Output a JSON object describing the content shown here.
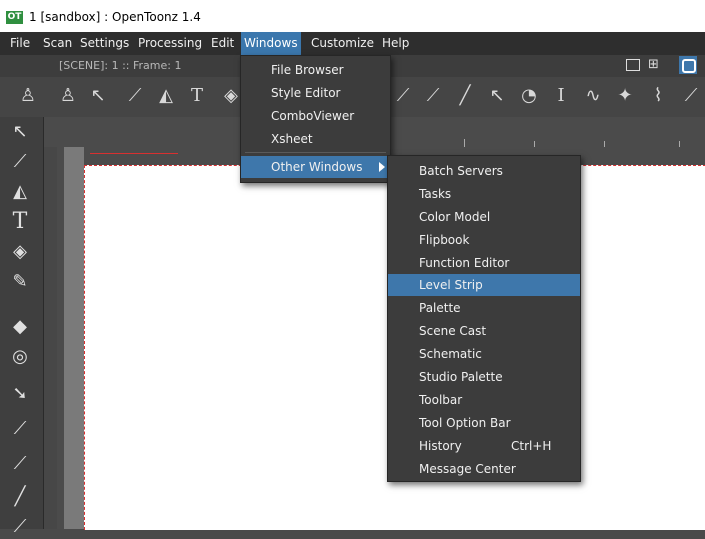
{
  "window": {
    "app_icon": "OT",
    "title": "1 [sandbox] : OpenToonz 1.4"
  },
  "menubar": {
    "items": [
      "File",
      "Scan",
      "Settings",
      "Processing",
      "Edit",
      "Windows",
      "Customize",
      "Help"
    ],
    "active": "Windows"
  },
  "toolbar": {
    "scene_info": "[SCENE]: 1  ::  Frame: 1"
  },
  "windows_menu": {
    "items": [
      "File Browser",
      "Style Editor",
      "ComboViewer",
      "Xsheet"
    ],
    "other_windows": "Other Windows"
  },
  "other_windows_menu": {
    "items": [
      "Batch Servers",
      "Tasks",
      "Color Model",
      "Flipbook",
      "Function Editor",
      "Level Strip",
      "Palette",
      "Scene Cast",
      "Schematic",
      "Studio Palette",
      "Toolbar",
      "Tool Option Bar",
      "History",
      "Message Center"
    ],
    "highlighted": "Level Strip",
    "history_shortcut": "Ctrl+H"
  },
  "colors": {
    "accent": "#3e77ab",
    "menubar": "#2e2e2e",
    "panel": "#3c3c3c"
  },
  "icons": [
    "animate-tool-icon",
    "selection-tool-icon",
    "brush-tool-icon",
    "geometric-tool-icon",
    "type-tool-icon",
    "fill-tool-icon",
    "paint-brush-tool-icon",
    "eraser-tool-icon",
    "tape-tool-icon",
    "finger-tool-icon",
    "style-picker-icon",
    "rgb-picker-icon",
    "ruler-tool-icon"
  ]
}
